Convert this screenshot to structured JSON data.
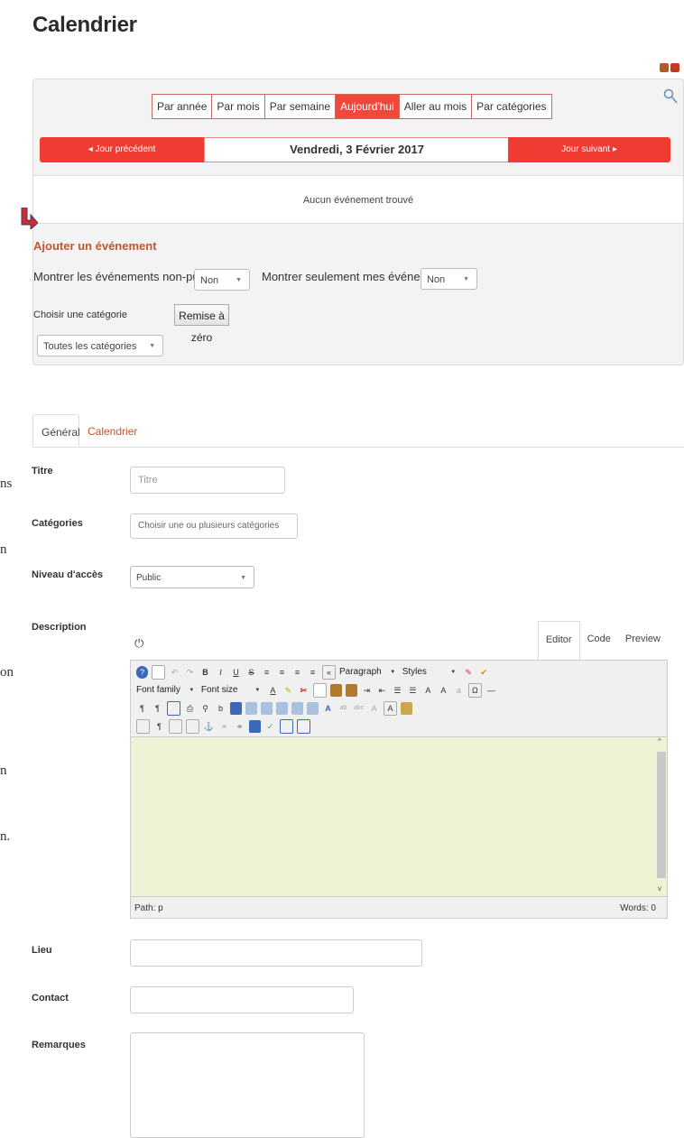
{
  "page": {
    "title": "Calendrier"
  },
  "calendar": {
    "view_tabs": [
      "Par année",
      "Par mois",
      "Par semaine",
      "Aujourd'hui",
      "Aller au mois",
      "Par catégories"
    ],
    "active_view": "Aujourd'hui",
    "prev_day": "Jour précédent",
    "current_day": "Vendredi, 3 Février 2017",
    "next_day": "Jour suivant",
    "no_events": "Aucun événement trouvé",
    "add_event": "Ajouter un événement",
    "show_unpublished_label": "Montrer les événements non-publiés ?",
    "show_unpublished_value": "Non",
    "show_mine_label": "Montrer seulement mes événements ?",
    "show_mine_value": "Non",
    "category_label": "Choisir une catégorie",
    "reset_label": "Remise à zéro",
    "category_value": "Toutes les catégories"
  },
  "form": {
    "tabs": [
      "Général",
      "Calendrier"
    ],
    "title_label": "Titre",
    "title_placeholder": "Titre",
    "categories_label": "Catégories",
    "categories_placeholder": "Choisir une ou plusieurs catégories",
    "access_label": "Niveau d'accès",
    "access_value": "Public",
    "description_label": "Description",
    "lieu_label": "Lieu",
    "contact_label": "Contact",
    "remarques_label": "Remarques"
  },
  "editor": {
    "tabs": [
      "Editor",
      "Code",
      "Preview"
    ],
    "paragraph_select": "Paragraph",
    "styles_select": "Styles",
    "font_family_select": "Font family",
    "font_size_select": "Font size",
    "path_label": "Path: p",
    "words_label": "Words: 0"
  },
  "margin_fragments": [
    "ns",
    "n",
    "on",
    "n",
    "n."
  ],
  "colors": {
    "accent_red": "#ef3b32",
    "link_orange": "#c0562c",
    "editor_bg": "#f0f2d5"
  }
}
